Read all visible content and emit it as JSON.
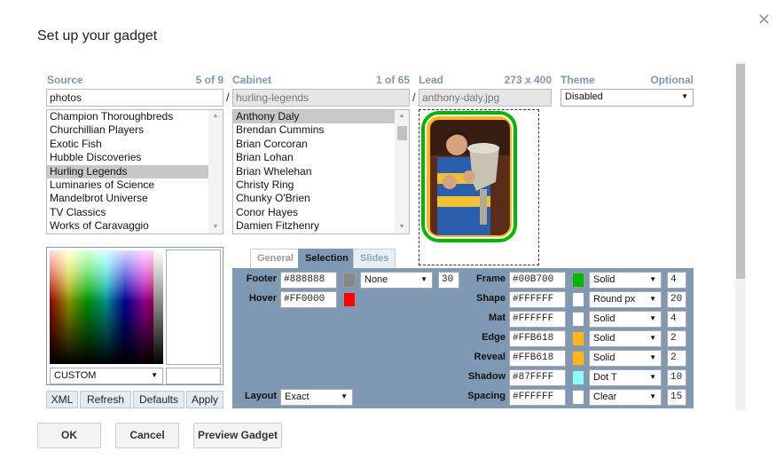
{
  "dialog": {
    "title": "Set up your gadget"
  },
  "source": {
    "header": "Source",
    "count": "5 of 9",
    "value": "photos",
    "items": [
      "Champion Thoroughbreds",
      "Churchillian Players",
      "Exotic Fish",
      "Hubble Discoveries",
      "Hurling Legends",
      "Luminaries of Science",
      "Mandelbrot Universe",
      "TV Classics",
      "Works of Caravaggio"
    ],
    "selected_index": 4
  },
  "cabinet": {
    "header": "Cabinet",
    "count": "1 of 65",
    "value": "hurling-legends",
    "items": [
      "Anthony Daly",
      "Brendan Cummins",
      "Brian Corcoran",
      "Brian Lohan",
      "Brian Whelehan",
      "Christy Ring",
      "Chunky O'Brien",
      "Conor Hayes",
      "Damien Fitzhenry"
    ],
    "selected_index": 0
  },
  "lead": {
    "header": "Lead",
    "size": "273 x 400",
    "value": "anthony-daly.jpg"
  },
  "theme": {
    "header": "Theme",
    "note": "Optional",
    "value": "Disabled"
  },
  "colors": {
    "frame": "#00B700",
    "reveal": "#FFB618",
    "picker_label": "CUSTOM"
  },
  "color_buttons": {
    "xml": "XML",
    "refresh": "Refresh",
    "defaults": "Defaults",
    "apply": "Apply"
  },
  "tabs": [
    "General",
    "Selection",
    "Slides"
  ],
  "left_settings": {
    "footer": {
      "label": "Footer",
      "hex": "#888888",
      "color": "#888888",
      "style": "None",
      "num": "30"
    },
    "hover": {
      "label": "Hover",
      "hex": "#FF0000",
      "color": "#FF0000"
    },
    "layout": {
      "label": "Layout",
      "value": "Exact"
    }
  },
  "right_settings": [
    {
      "label": "Frame",
      "hex": "#00B700",
      "color": "#00B700",
      "style": "Solid",
      "num": "4"
    },
    {
      "label": "Shape",
      "hex": "#FFFFFF",
      "color": "#FFFFFF",
      "style": "Round px",
      "num": "20"
    },
    {
      "label": "Mat",
      "hex": "#FFFFFF",
      "color": "#FFFFFF",
      "style": "Solid",
      "num": "4"
    },
    {
      "label": "Edge",
      "hex": "#FFB618",
      "color": "#FFB618",
      "style": "Solid",
      "num": "2"
    },
    {
      "label": "Reveal",
      "hex": "#FFB618",
      "color": "#FFB618",
      "style": "Solid",
      "num": "2"
    },
    {
      "label": "Shadow",
      "hex": "#87FFFF",
      "color": "#87FFFF",
      "style": "Dot T",
      "num": "10"
    },
    {
      "label": "Spacing",
      "hex": "#FFFFFF",
      "color": "#FFFFFF",
      "style": "Clear",
      "num": "15"
    }
  ],
  "footer_buttons": {
    "ok": "OK",
    "cancel": "Cancel",
    "preview": "Preview Gadget"
  }
}
